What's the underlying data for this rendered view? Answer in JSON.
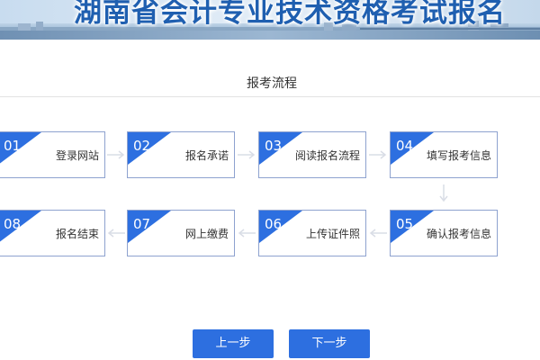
{
  "banner": {
    "title": "湖南省会计专业技术资格考试报名"
  },
  "section": {
    "title": "报考流程"
  },
  "steps": [
    {
      "num": "01",
      "label": "登录网站"
    },
    {
      "num": "02",
      "label": "报名承诺"
    },
    {
      "num": "03",
      "label": "阅读报名流程"
    },
    {
      "num": "04",
      "label": "填写报考信息"
    },
    {
      "num": "05",
      "label": "确认报考信息"
    },
    {
      "num": "06",
      "label": "上传证件照"
    },
    {
      "num": "07",
      "label": "网上缴费"
    },
    {
      "num": "08",
      "label": "报名结束"
    }
  ],
  "buttons": {
    "prev": "上一步",
    "next": "下一步"
  },
  "colors": {
    "accent": "#2d6fe0",
    "border": "#8ea2cf",
    "title": "#1f5fb0"
  }
}
